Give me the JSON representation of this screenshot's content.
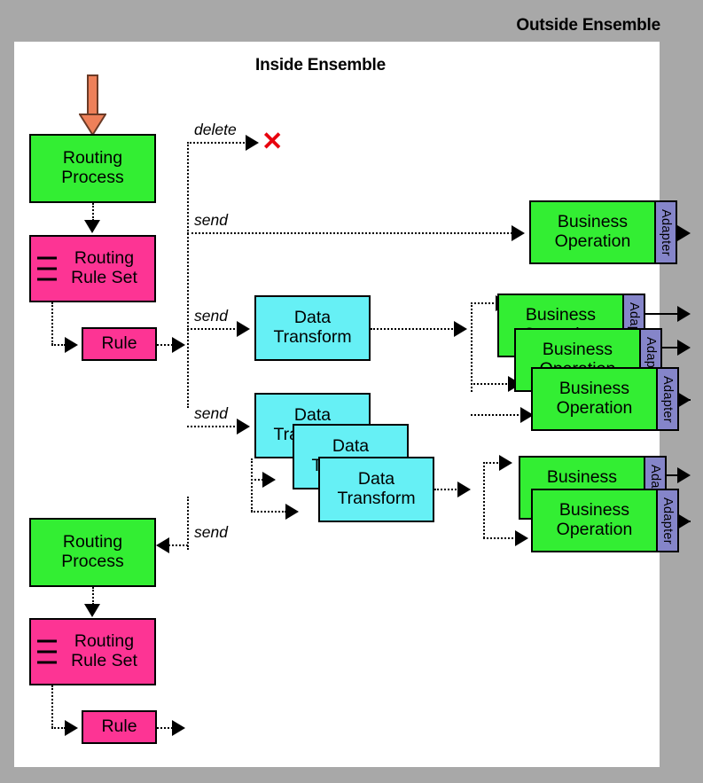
{
  "titles": {
    "outside": "Outside Ensemble",
    "inside": "Inside Ensemble"
  },
  "colors": {
    "background": "#a8a8a8",
    "panel": "#ffffff",
    "process": "#33ee33",
    "rule": "#fd3494",
    "transform": "#66f0f5",
    "adapter": "#8585c9",
    "input_arrow": "#ee8059",
    "delete_mark": "#e8000d"
  },
  "labels": {
    "routing_process": "Routing\nProcess",
    "routing_rule_set": "Routing\nRule Set",
    "rule": "Rule",
    "data_transform": "Data\nTransform",
    "business_operation": "Business\nOperation",
    "business_operation_short": "Business",
    "adapter": "Adapter",
    "delete": "delete",
    "send": "send",
    "delete_mark": "✕"
  },
  "nodes": {
    "top_routing_process": {
      "label": "Routing\nProcess"
    },
    "top_rule_set": {
      "label": "Routing\nRule Set"
    },
    "top_rule": {
      "label": "Rule"
    },
    "bottom_routing_process": {
      "label": "Routing\nProcess"
    },
    "bottom_rule_set": {
      "label": "Routing\nRule Set"
    },
    "bottom_rule": {
      "label": "Rule"
    },
    "transform_single": {
      "label": "Data\nTransform"
    },
    "transform_stack_1": {
      "label": "Data\nTransform"
    },
    "transform_stack_2": {
      "label": "Data\nTransform"
    },
    "transform_stack_3": {
      "label": "Data\nTransform"
    },
    "bizop_top": {
      "label": "Business\nOperation",
      "adapter": "Adapter"
    },
    "bizop_mid_1": {
      "label": "Business\nOperation",
      "adapter": "Adapter"
    },
    "bizop_mid_2": {
      "label": "Business\nOperation",
      "adapter": "Adapter"
    },
    "bizop_mid_3": {
      "label": "Business\nOperation",
      "adapter": "Adapter"
    },
    "bizop_low_1": {
      "label": "Business\nOperation",
      "adapter": "Adapter"
    },
    "bizop_low_2": {
      "label": "Business\nOperation",
      "adapter": "Adapter"
    }
  },
  "edges": [
    {
      "name": "delete-edge",
      "label": "delete"
    },
    {
      "name": "send-edge-1",
      "label": "send"
    },
    {
      "name": "send-edge-2",
      "label": "send"
    },
    {
      "name": "send-edge-3",
      "label": "send"
    },
    {
      "name": "send-edge-4",
      "label": "send"
    }
  ]
}
